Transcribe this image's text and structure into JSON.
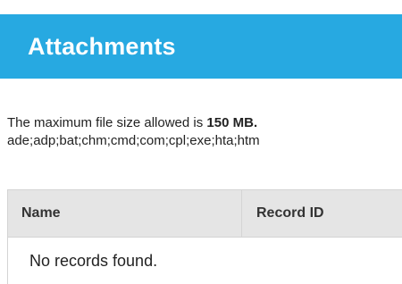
{
  "header": {
    "title": "Attachments"
  },
  "info": {
    "size_prefix": "The maximum file size allowed is",
    "size_value": "150 MB.",
    "extensions": "ade;adp;bat;chm;cmd;com;cpl;exe;hta;htm"
  },
  "table": {
    "columns": [
      "Name",
      "Record ID"
    ],
    "empty_message": "No records found."
  },
  "colors": {
    "header_bg": "#27a9e1",
    "table_header_bg": "#e5e5e5"
  }
}
